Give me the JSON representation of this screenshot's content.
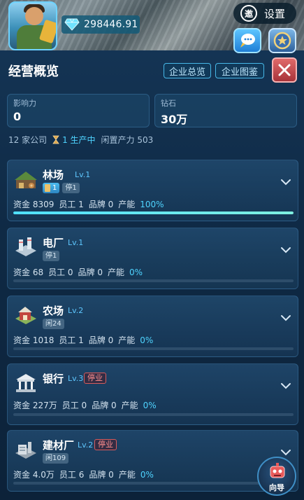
{
  "topbar": {
    "diamond_balance": "298446.91",
    "invite_label": "邀",
    "settings_label": "设置"
  },
  "panel": {
    "title": "经营概览",
    "overview_btn": "企业总览",
    "catalog_btn": "企业图鉴"
  },
  "stats": {
    "influence_label": "影响力",
    "influence_value": "0",
    "diamond_label": "钻石",
    "diamond_value": "30万"
  },
  "summary": {
    "companies": "12 家公司",
    "producing": "1 生产中",
    "idle": "闲置产力 503"
  },
  "companies": [
    {
      "name": "林场",
      "level": "Lv.1",
      "stop_tag": "",
      "chips": [
        "1",
        "停1"
      ],
      "funds": "资金 8309",
      "staff": "员工 1",
      "brand": "品牌 0",
      "capacity_label": "产能",
      "capacity": "100%",
      "progress": 1.0,
      "icon": "lumber-yard-icon"
    },
    {
      "name": "电厂",
      "level": "Lv.1",
      "stop_tag": "",
      "chips": [
        "停1"
      ],
      "funds": "资金 68",
      "staff": "员工 0",
      "brand": "品牌 0",
      "capacity_label": "产能",
      "capacity": "0%",
      "progress": 0,
      "icon": "power-plant-icon"
    },
    {
      "name": "农场",
      "level": "Lv.2",
      "stop_tag": "",
      "chips": [
        "闲24"
      ],
      "funds": "资金 1018",
      "staff": "员工 1",
      "brand": "品牌 0",
      "capacity_label": "产能",
      "capacity": "0%",
      "progress": 0,
      "icon": "farm-icon"
    },
    {
      "name": "银行",
      "level": "Lv.3",
      "stop_tag": "停业",
      "chips": [],
      "funds": "资金 227万",
      "staff": "员工 0",
      "brand": "品牌 0",
      "capacity_label": "产能",
      "capacity": "0%",
      "progress": 0,
      "icon": "bank-icon"
    },
    {
      "name": "建材厂",
      "level": "Lv.2",
      "stop_tag": "停业",
      "chips": [
        "闲109"
      ],
      "funds": "资金 4.0万",
      "staff": "员工 6",
      "brand": "品牌 0",
      "capacity_label": "产能",
      "capacity": "0%",
      "progress": 0,
      "icon": "building-materials-factory-icon"
    }
  ],
  "guide": {
    "label": "向导"
  },
  "colors": {
    "accent": "#4fd4ff",
    "stop_red": "#ff8d8d",
    "close_red": "#c44a50"
  }
}
